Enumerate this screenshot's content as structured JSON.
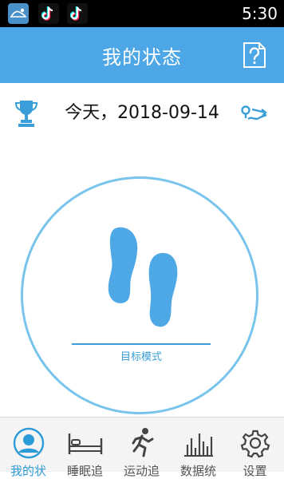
{
  "status_bar": {
    "time": "5:30",
    "app_icons": [
      "shoe-app-icon",
      "tiktok-icon",
      "tiktok-icon"
    ]
  },
  "app_bar": {
    "title": "我的状态",
    "help_icon": "question-mark-doc-icon"
  },
  "date_row": {
    "date_text": "今天，2018-09-14",
    "left_icon": "trophy-icon",
    "right_icon": "route-icon"
  },
  "main": {
    "center_icon": "footprints-icon",
    "mode_label": "目标模式"
  },
  "tabs": [
    {
      "label": "我的状",
      "icon": "person-icon",
      "active": true
    },
    {
      "label": "睡眠追",
      "icon": "bed-icon",
      "active": false
    },
    {
      "label": "运动追",
      "icon": "runner-icon",
      "active": false
    },
    {
      "label": "数据统",
      "icon": "bar-chart-icon",
      "active": false
    },
    {
      "label": "设置",
      "icon": "gear-icon",
      "active": false
    }
  ],
  "colors": {
    "accent": "#4da6e6",
    "circle": "#79c4ec",
    "active_tab": "#2d9bd8"
  }
}
